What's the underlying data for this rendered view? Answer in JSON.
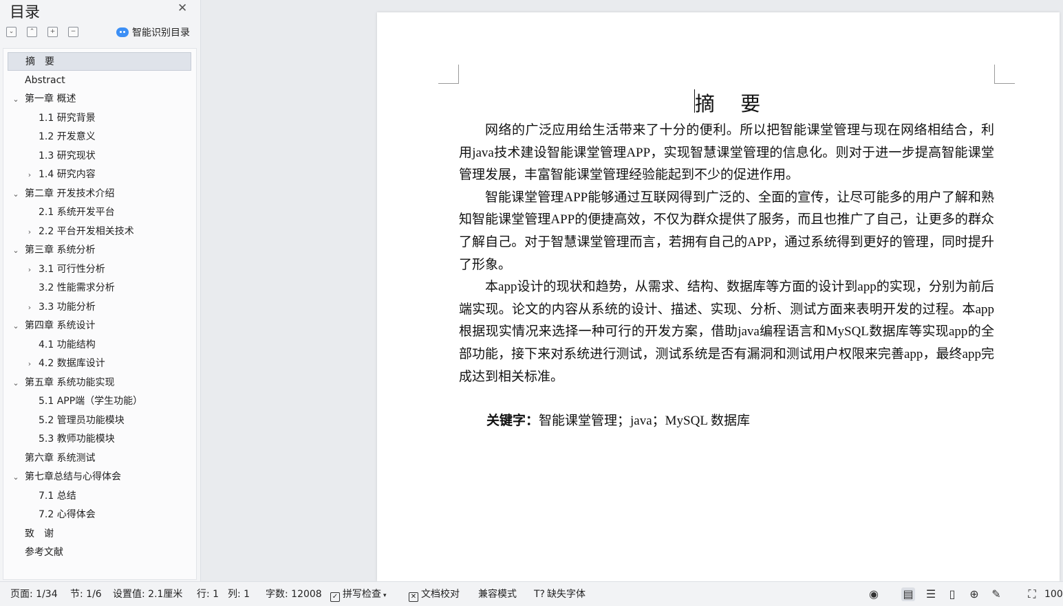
{
  "toc": {
    "title": "目录",
    "smart_label": "智能识别目录",
    "items": [
      {
        "label": "摘　要",
        "active": true
      },
      {
        "label": "Abstract"
      },
      {
        "label": "第一章  概述",
        "expanded": true
      },
      {
        "label": "1.1 研究背景"
      },
      {
        "label": "1.2 开发意义"
      },
      {
        "label": "1.3  研究现状"
      },
      {
        "label": "1.4  研究内容",
        "collapsed": true
      },
      {
        "label": "第二章  开发技术介绍",
        "expanded": true
      },
      {
        "label": "2.1  系统开发平台"
      },
      {
        "label": "2.2  平台开发相关技术",
        "collapsed": true
      },
      {
        "label": "第三章  系统分析",
        "expanded": true
      },
      {
        "label": "3.1  可行性分析",
        "collapsed": true
      },
      {
        "label": "3.2 性能需求分析"
      },
      {
        "label": "3.3 功能分析",
        "collapsed": true
      },
      {
        "label": "第四章  系统设计",
        "expanded": true
      },
      {
        "label": "4.1 功能结构"
      },
      {
        "label": "4.2  数据库设计",
        "collapsed": true
      },
      {
        "label": "第五章  系统功能实现",
        "expanded": true
      },
      {
        "label": "5.1 APP端（学生功能）"
      },
      {
        "label": "5.2 管理员功能模块"
      },
      {
        "label": "5.3 教师功能模块"
      },
      {
        "label": "第六章  系统测试"
      },
      {
        "label": "第七章总结与心得体会",
        "expanded": true
      },
      {
        "label": "7.1  总结"
      },
      {
        "label": "7.2  心得体会"
      },
      {
        "label": "致　谢"
      },
      {
        "label": "参考文献"
      }
    ]
  },
  "document": {
    "heading": "摘  要",
    "paragraphs": [
      "网络的广泛应用给生活带来了十分的便利。所以把智能课堂管理与现在网络相结合，利用java技术建设智能课堂管理APP，实现智慧课堂管理的信息化。则对于进一步提高智能课堂管理发展，丰富智能课堂管理经验能起到不少的促进作用。",
      "智能课堂管理APP能够通过互联网得到广泛的、全面的宣传，让尽可能多的用户了解和熟知智能课堂管理APP的便捷高效，不仅为群众提供了服务，而且也推广了自己，让更多的群众了解自己。对于智慧课堂管理而言，若拥有自己的APP，通过系统得到更好的管理，同时提升了形象。",
      "本app设计的现状和趋势，从需求、结构、数据库等方面的设计到app的实现，分别为前后端实现。论文的内容从系统的设计、描述、实现、分析、测试方面来表明开发的过程。本app根据现实情况来选择一种可行的开发方案，借助java编程语言和MySQL数据库等实现app的全部功能，接下来对系统进行测试，测试系统是否有漏洞和测试用户权限来完善app，最终app完成达到相关标准。"
    ],
    "keywords_label": "关键字：",
    "keywords": "智能课堂管理；java；MySQL 数据库"
  },
  "status": {
    "page": "页面: 1/34",
    "section": "节: 1/6",
    "setting": "设置值: 2.1厘米",
    "row": "行: 1",
    "col": "列: 1",
    "words": "字数: 12008",
    "spell": "拼写检查",
    "proof": "文档校对",
    "compat": "兼容模式",
    "missing_font": "缺失字体",
    "zoom": "100"
  }
}
